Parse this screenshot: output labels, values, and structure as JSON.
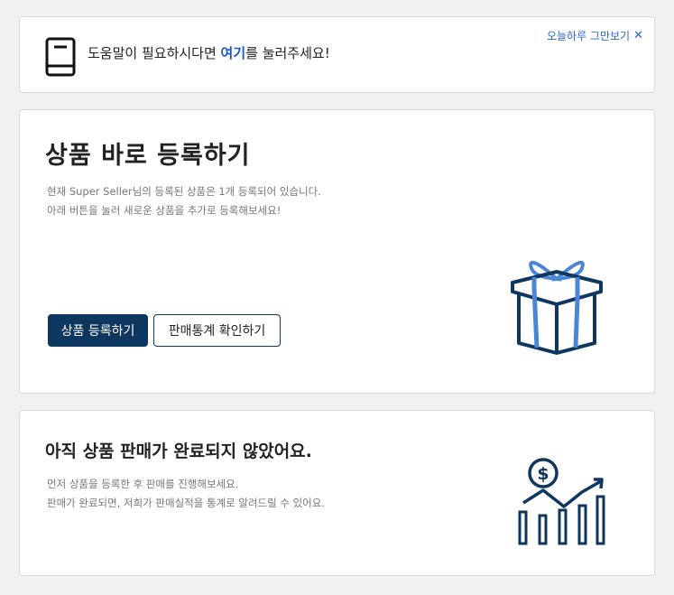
{
  "help_banner": {
    "text_before": "도움말이 필요하시다면 ",
    "link_text": "여기",
    "text_after": "를 눌러주세요!",
    "dismiss_label": "오늘하루 그만보기",
    "dismiss_icon": "close-icon",
    "book_icon": "book-icon"
  },
  "register_card": {
    "title": "상품 바로 등록하기",
    "desc_line1": "현재 Super Seller님의 등록된 상품은 1개 등록되어 있습니다.",
    "desc_line2": "아래 버튼을 눌러 새로운 상품을 추가로 등록해보세요!",
    "primary_button": "상품 등록하기",
    "secondary_button": "판매통계 확인하기",
    "icon": "gift-icon"
  },
  "sales_card": {
    "title": "아직 상품 판매가 완료되지 않았어요.",
    "desc_line1": "먼저 상품을 등록한 후 판매를 진행해보세요.",
    "desc_line2": "판매가 완료되면, 저희가 판매실적을 통계로 알려드릴 수 있어요.",
    "icon": "sales-chart-icon"
  },
  "colors": {
    "navy": "#0e3760",
    "accent_blue": "#4a86d4",
    "link_blue": "#1a56c8",
    "background": "#f1f1f1"
  }
}
